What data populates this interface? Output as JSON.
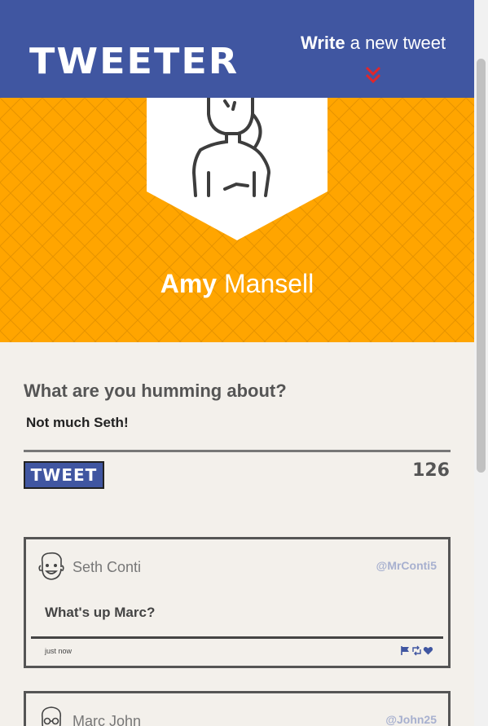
{
  "header": {
    "logo": "TWEETER",
    "write_strong": "Write",
    "write_rest": " a new tweet",
    "accent_color": "#4056a1",
    "chevron_color": "#e0262b"
  },
  "profile": {
    "first_name": "Amy",
    "last_name": " Mansell",
    "banner_color": "#ffa500"
  },
  "compose": {
    "prompt": "What are you humming about?",
    "text": "Not much Seth!",
    "button_label": "TWEET",
    "char_count": "126"
  },
  "tweets": [
    {
      "name": "Seth Conti",
      "handle": "@MrConti5",
      "body": "What's up Marc?",
      "time": "just now",
      "actions": [
        "flag-icon",
        "retweet-icon",
        "heart-icon"
      ]
    },
    {
      "name": "Marc John",
      "handle": "@John25"
    }
  ]
}
